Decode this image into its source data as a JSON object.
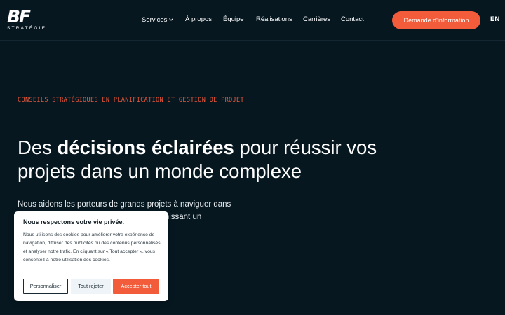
{
  "header": {
    "logo_mark": "BF",
    "logo_sub": "STRATÉGIE",
    "nav": [
      {
        "label": "Services"
      },
      {
        "label": "À propos"
      },
      {
        "label": "Équipe"
      },
      {
        "label": "Réalisations"
      },
      {
        "label": "Carrières"
      },
      {
        "label": "Contact"
      }
    ],
    "services_dropdown_icon": "chevron-down-icon",
    "cta_label": "Demande d'information",
    "lang_label": "EN"
  },
  "hero": {
    "eyebrow": "CONSEILS STRATÉGIQUES EN PLANIFICATION ET GESTION DE PROJET",
    "headline_pre": "Des ",
    "headline_bold": "décisions éclairées",
    "headline_post": " pour réussir vos projets dans un monde complexe",
    "intro_line1": "Nous aidons les porteurs de grands projets à naviguer dans",
    "intro_line2": "fournissant un"
  },
  "cookie_banner": {
    "title": "Nous respectons votre vie privée.",
    "text": "Nous utilisons des cookies pour améliorer votre expérience de navigation, diffuser des publicités ou des contenus personnalisés et analyser notre trafic. En cliquant sur « Tout accepter », vous consentez à notre utilisation des cookies.",
    "customize_label": "Personnaliser",
    "reject_label": "Tout rejeter",
    "accept_label": "Accepter tout"
  },
  "colors": {
    "background": "#061720",
    "accent": "#f25c3a"
  }
}
